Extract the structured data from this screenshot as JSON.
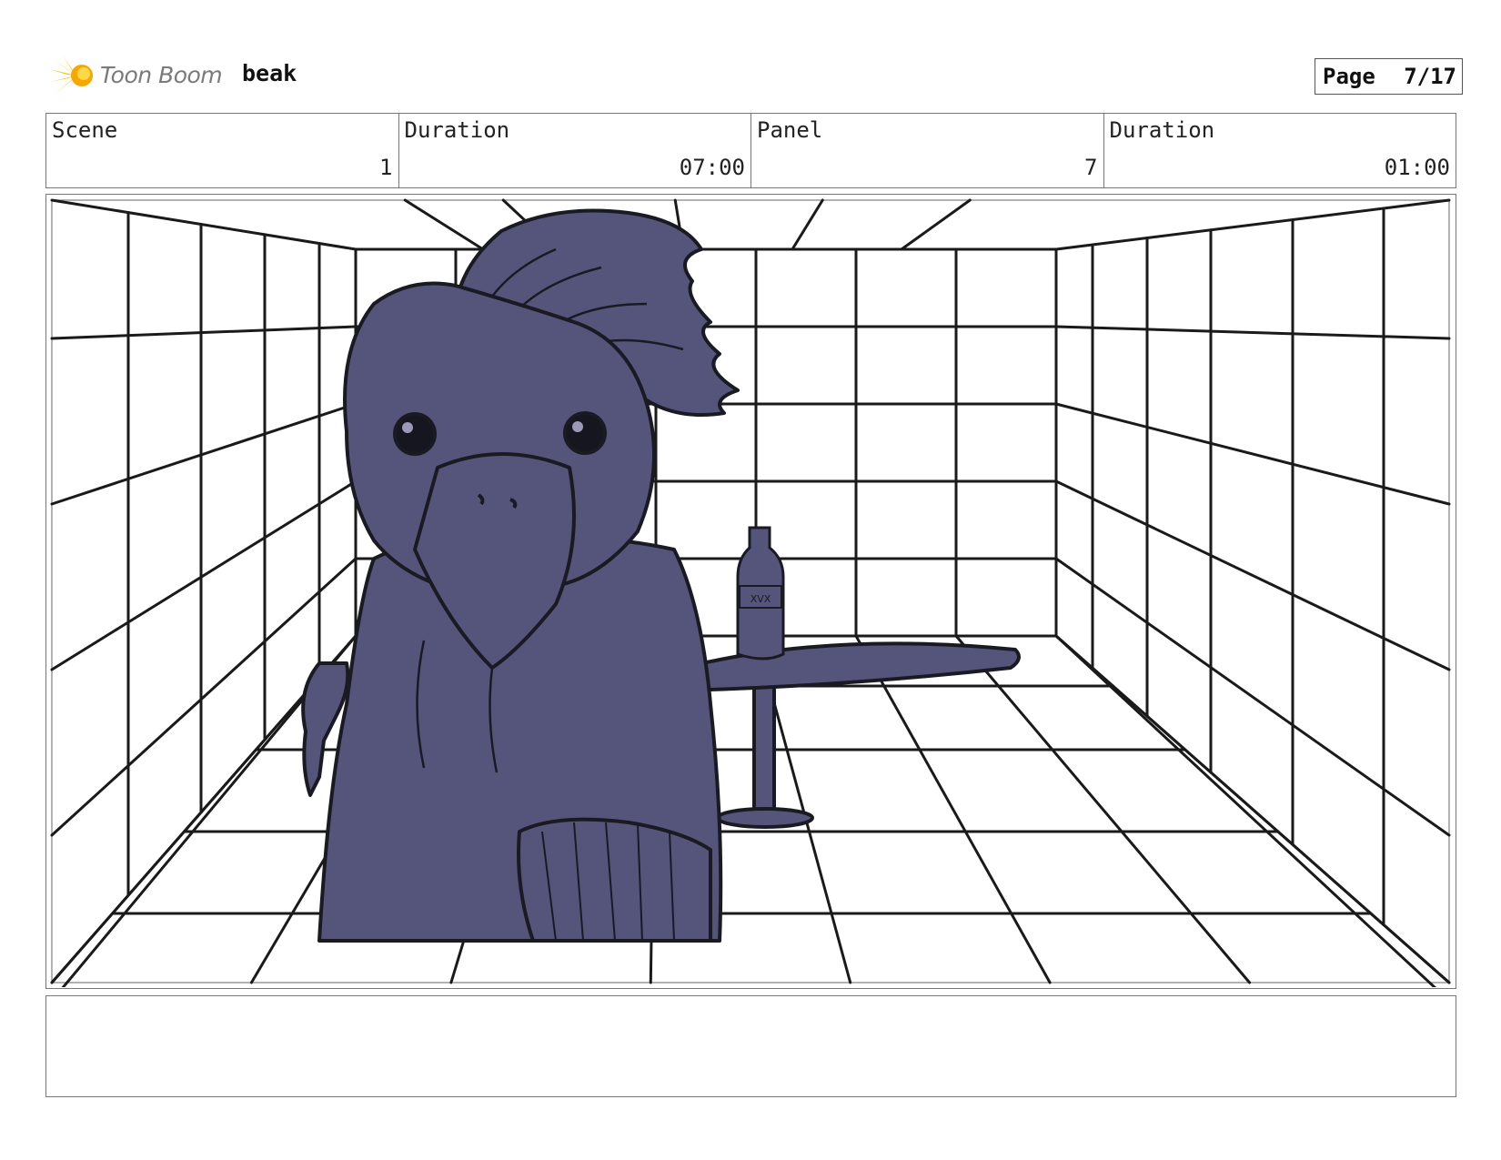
{
  "header": {
    "brand": "Toon Boom",
    "project": "beak",
    "page_label": "Page",
    "page_number": "7/17"
  },
  "info": {
    "scene_label": "Scene",
    "scene_value": "1",
    "scene_duration_label": "Duration",
    "scene_duration_value": "07:00",
    "panel_label": "Panel",
    "panel_value": "7",
    "panel_duration_label": "Duration",
    "panel_duration_value": "01:00"
  },
  "drawing": {
    "bottle_label": "XVX",
    "character_color": "#55557c",
    "ink_color": "#1a1a22"
  },
  "notes": {
    "text": ""
  }
}
